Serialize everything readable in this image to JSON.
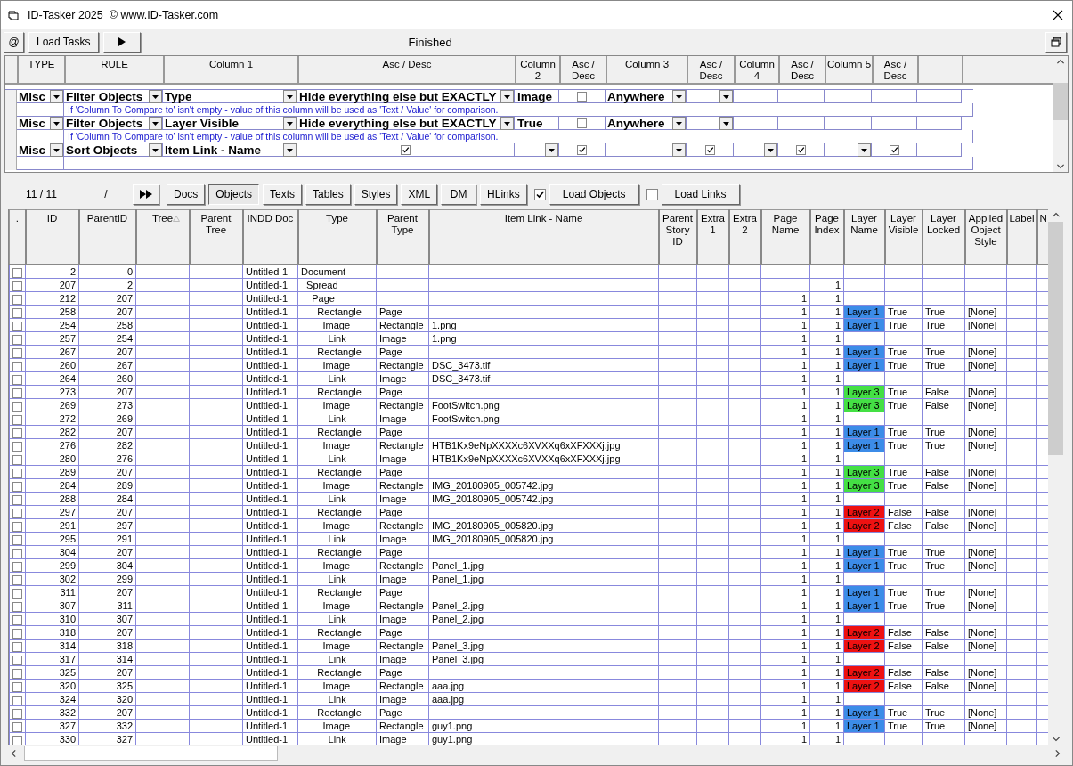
{
  "window": {
    "title": "ID-Tasker 2025  © www.ID-Tasker.com"
  },
  "toolbar": {
    "at_button": "@",
    "load_tasks_button": "Load Tasks",
    "status": "Finished"
  },
  "rules": {
    "columns": [
      "TYPE",
      "RULE",
      "Column 1",
      "Asc / Desc",
      "Column 2",
      "Asc / Desc",
      "Column 3",
      "Asc / Desc",
      "Column 4",
      "Asc / Desc",
      "Column 5",
      "Asc / Desc"
    ],
    "rows": [
      {
        "cells": [
          {
            "kind": "combo",
            "text": "Misc"
          },
          {
            "kind": "combo",
            "text": "Filter Objects"
          },
          {
            "kind": "combo",
            "text": "Type"
          },
          {
            "kind": "combo",
            "text": "Hide everything else but EXACTLY"
          },
          {
            "kind": "text",
            "text": "Image"
          },
          {
            "kind": "check",
            "checked": false
          },
          {
            "kind": "combo",
            "text": "Anywhere"
          },
          {
            "kind": "combo"
          },
          {
            "kind": "empty"
          },
          {
            "kind": "empty"
          },
          {
            "kind": "empty"
          },
          {
            "kind": "empty"
          },
          {
            "kind": "empty"
          }
        ],
        "note": "If 'Column To Compare to' isn't empty - value of this column will be used as 'Text / Value' for comparison."
      },
      {
        "cells": [
          {
            "kind": "combo",
            "text": "Misc"
          },
          {
            "kind": "combo",
            "text": "Filter Objects"
          },
          {
            "kind": "combo",
            "text": "Layer Visible"
          },
          {
            "kind": "combo",
            "text": "Hide everything else but EXACTLY"
          },
          {
            "kind": "text",
            "text": "True"
          },
          {
            "kind": "check",
            "checked": false
          },
          {
            "kind": "combo",
            "text": "Anywhere"
          },
          {
            "kind": "combo"
          },
          {
            "kind": "empty"
          },
          {
            "kind": "empty"
          },
          {
            "kind": "empty"
          },
          {
            "kind": "empty"
          },
          {
            "kind": "empty"
          }
        ],
        "note": "If 'Column To Compare to' isn't empty - value of this column will be used as 'Text / Value' for comparison."
      },
      {
        "cells": [
          {
            "kind": "combo",
            "text": "Misc"
          },
          {
            "kind": "combo",
            "text": "Sort Objects"
          },
          {
            "kind": "combo",
            "text": "Item Link - Name"
          },
          {
            "kind": "check",
            "checked": true
          },
          {
            "kind": "combo"
          },
          {
            "kind": "check",
            "checked": true
          },
          {
            "kind": "combo"
          },
          {
            "kind": "check",
            "checked": true
          },
          {
            "kind": "combo"
          },
          {
            "kind": "check",
            "checked": true
          },
          {
            "kind": "combo"
          },
          {
            "kind": "check",
            "checked": true
          },
          {
            "kind": "empty"
          }
        ]
      }
    ]
  },
  "navigator": {
    "counter": "11 / 11",
    "separator": "/"
  },
  "tabs": [
    {
      "label": "Docs",
      "selected": false
    },
    {
      "label": "Objects",
      "selected": true
    },
    {
      "label": "Texts",
      "selected": false
    },
    {
      "label": "Tables",
      "selected": false
    },
    {
      "label": "Styles",
      "selected": false
    },
    {
      "label": "XML",
      "selected": false
    },
    {
      "label": "DM",
      "selected": false
    },
    {
      "label": "HLinks",
      "selected": false
    }
  ],
  "loaders": [
    {
      "label": "Load Objects",
      "checked": true
    },
    {
      "label": "Load Links",
      "checked": false
    }
  ],
  "table": {
    "checkbox_column_header": ".",
    "columns": [
      "ID",
      "ParentID",
      "Tree",
      "Parent Tree",
      "INDD Doc",
      "Type",
      "Parent Type",
      "Item Link - Name",
      "Parent Story ID",
      "Extra 1",
      "Extra 2",
      "Page Name",
      "Page Index",
      "Layer Name",
      "Layer Visible",
      "Layer Locked",
      "Applied Object Style",
      "Label",
      "N"
    ],
    "rows": [
      {
        "checked": false,
        "cells": [
          "2",
          "0",
          null,
          null,
          "Untitled-1",
          "Document"
        ]
      },
      {
        "checked": false,
        "cells": [
          "207",
          "2",
          null,
          null,
          "Untitled-1",
          "  Spread",
          null,
          null,
          null,
          null,
          null,
          null,
          "1"
        ]
      },
      {
        "checked": false,
        "cells": [
          "212",
          "207",
          null,
          null,
          "Untitled-1",
          "    Page",
          null,
          null,
          null,
          null,
          null,
          "1",
          "1"
        ]
      },
      {
        "checked": false,
        "color": "#3c8ce8",
        "cells": [
          "258",
          "207",
          null,
          null,
          "Untitled-1",
          "      Rectangle",
          "Page",
          null,
          null,
          null,
          null,
          "1",
          "1",
          "Layer 1",
          "True",
          "True",
          "[None]"
        ]
      },
      {
        "checked": false,
        "color": "#3c8ce8",
        "cells": [
          "254",
          "258",
          null,
          null,
          "Untitled-1",
          "        Image",
          "Rectangle",
          "1.png",
          null,
          null,
          null,
          "1",
          "1",
          "Layer 1",
          "True",
          "True",
          "[None]"
        ]
      },
      {
        "checked": false,
        "cells": [
          "257",
          "254",
          null,
          null,
          "Untitled-1",
          "          Link",
          "Image",
          "1.png",
          null,
          null,
          null,
          "1",
          "1"
        ]
      },
      {
        "checked": false,
        "color": "#3c8ce8",
        "cells": [
          "267",
          "207",
          null,
          null,
          "Untitled-1",
          "      Rectangle",
          "Page",
          null,
          null,
          null,
          null,
          "1",
          "1",
          "Layer 1",
          "True",
          "True",
          "[None]"
        ]
      },
      {
        "checked": false,
        "color": "#3c8ce8",
        "cells": [
          "260",
          "267",
          null,
          null,
          "Untitled-1",
          "        Image",
          "Rectangle",
          "DSC_3473.tif",
          null,
          null,
          null,
          "1",
          "1",
          "Layer 1",
          "True",
          "True",
          "[None]"
        ]
      },
      {
        "checked": false,
        "cells": [
          "264",
          "260",
          null,
          null,
          "Untitled-1",
          "          Link",
          "Image",
          "DSC_3473.tif",
          null,
          null,
          null,
          "1",
          "1"
        ]
      },
      {
        "checked": false,
        "color": "#44e044",
        "cells": [
          "273",
          "207",
          null,
          null,
          "Untitled-1",
          "      Rectangle",
          "Page",
          null,
          null,
          null,
          null,
          "1",
          "1",
          "Layer 3",
          "True",
          "False",
          "[None]"
        ]
      },
      {
        "checked": false,
        "color": "#44e044",
        "cells": [
          "269",
          "273",
          null,
          null,
          "Untitled-1",
          "        Image",
          "Rectangle",
          "FootSwitch.png",
          null,
          null,
          null,
          "1",
          "1",
          "Layer 3",
          "True",
          "False",
          "[None]"
        ]
      },
      {
        "checked": false,
        "cells": [
          "272",
          "269",
          null,
          null,
          "Untitled-1",
          "          Link",
          "Image",
          "FootSwitch.png",
          null,
          null,
          null,
          "1",
          "1"
        ]
      },
      {
        "checked": false,
        "color": "#3c8ce8",
        "cells": [
          "282",
          "207",
          null,
          null,
          "Untitled-1",
          "      Rectangle",
          "Page",
          null,
          null,
          null,
          null,
          "1",
          "1",
          "Layer 1",
          "True",
          "True",
          "[None]"
        ]
      },
      {
        "checked": false,
        "color": "#3c8ce8",
        "cells": [
          "276",
          "282",
          null,
          null,
          "Untitled-1",
          "        Image",
          "Rectangle",
          "HTB1Kx9eNpXXXXc6XVXXq6xXFXXXj.jpg",
          null,
          null,
          null,
          "1",
          "1",
          "Layer 1",
          "True",
          "True",
          "[None]"
        ]
      },
      {
        "checked": false,
        "cells": [
          "280",
          "276",
          null,
          null,
          "Untitled-1",
          "          Link",
          "Image",
          "HTB1Kx9eNpXXXXc6XVXXq6xXFXXXj.jpg",
          null,
          null,
          null,
          "1",
          "1"
        ]
      },
      {
        "checked": false,
        "color": "#44e044",
        "cells": [
          "289",
          "207",
          null,
          null,
          "Untitled-1",
          "      Rectangle",
          "Page",
          null,
          null,
          null,
          null,
          "1",
          "1",
          "Layer 3",
          "True",
          "False",
          "[None]"
        ]
      },
      {
        "checked": false,
        "color": "#44e044",
        "cells": [
          "284",
          "289",
          null,
          null,
          "Untitled-1",
          "        Image",
          "Rectangle",
          "IMG_20180905_005742.jpg",
          null,
          null,
          null,
          "1",
          "1",
          "Layer 3",
          "True",
          "False",
          "[None]"
        ]
      },
      {
        "checked": false,
        "cells": [
          "288",
          "284",
          null,
          null,
          "Untitled-1",
          "          Link",
          "Image",
          "IMG_20180905_005742.jpg",
          null,
          null,
          null,
          "1",
          "1"
        ]
      },
      {
        "checked": false,
        "color": "#ee1111",
        "cells": [
          "297",
          "207",
          null,
          null,
          "Untitled-1",
          "      Rectangle",
          "Page",
          null,
          null,
          null,
          null,
          "1",
          "1",
          "Layer 2",
          "False",
          "False",
          "[None]"
        ]
      },
      {
        "checked": false,
        "color": "#ee1111",
        "cells": [
          "291",
          "297",
          null,
          null,
          "Untitled-1",
          "        Image",
          "Rectangle",
          "IMG_20180905_005820.jpg",
          null,
          null,
          null,
          "1",
          "1",
          "Layer 2",
          "False",
          "False",
          "[None]"
        ]
      },
      {
        "checked": false,
        "cells": [
          "295",
          "291",
          null,
          null,
          "Untitled-1",
          "          Link",
          "Image",
          "IMG_20180905_005820.jpg",
          null,
          null,
          null,
          "1",
          "1"
        ]
      },
      {
        "checked": false,
        "color": "#3c8ce8",
        "cells": [
          "304",
          "207",
          null,
          null,
          "Untitled-1",
          "      Rectangle",
          "Page",
          null,
          null,
          null,
          null,
          "1",
          "1",
          "Layer 1",
          "True",
          "True",
          "[None]"
        ]
      },
      {
        "checked": false,
        "color": "#3c8ce8",
        "cells": [
          "299",
          "304",
          null,
          null,
          "Untitled-1",
          "        Image",
          "Rectangle",
          "Panel_1.jpg",
          null,
          null,
          null,
          "1",
          "1",
          "Layer 1",
          "True",
          "True",
          "[None]"
        ]
      },
      {
        "checked": false,
        "cells": [
          "302",
          "299",
          null,
          null,
          "Untitled-1",
          "          Link",
          "Image",
          "Panel_1.jpg",
          null,
          null,
          null,
          "1",
          "1"
        ]
      },
      {
        "checked": false,
        "color": "#3c8ce8",
        "cells": [
          "311",
          "207",
          null,
          null,
          "Untitled-1",
          "      Rectangle",
          "Page",
          null,
          null,
          null,
          null,
          "1",
          "1",
          "Layer 1",
          "True",
          "True",
          "[None]"
        ]
      },
      {
        "checked": false,
        "color": "#3c8ce8",
        "cells": [
          "307",
          "311",
          null,
          null,
          "Untitled-1",
          "        Image",
          "Rectangle",
          "Panel_2.jpg",
          null,
          null,
          null,
          "1",
          "1",
          "Layer 1",
          "True",
          "True",
          "[None]"
        ]
      },
      {
        "checked": false,
        "cells": [
          "310",
          "307",
          null,
          null,
          "Untitled-1",
          "          Link",
          "Image",
          "Panel_2.jpg",
          null,
          null,
          null,
          "1",
          "1"
        ]
      },
      {
        "checked": false,
        "color": "#ee1111",
        "cells": [
          "318",
          "207",
          null,
          null,
          "Untitled-1",
          "      Rectangle",
          "Page",
          null,
          null,
          null,
          null,
          "1",
          "1",
          "Layer 2",
          "False",
          "False",
          "[None]"
        ]
      },
      {
        "checked": false,
        "color": "#ee1111",
        "cells": [
          "314",
          "318",
          null,
          null,
          "Untitled-1",
          "        Image",
          "Rectangle",
          "Panel_3.jpg",
          null,
          null,
          null,
          "1",
          "1",
          "Layer 2",
          "False",
          "False",
          "[None]"
        ]
      },
      {
        "checked": false,
        "cells": [
          "317",
          "314",
          null,
          null,
          "Untitled-1",
          "          Link",
          "Image",
          "Panel_3.jpg",
          null,
          null,
          null,
          "1",
          "1"
        ]
      },
      {
        "checked": false,
        "color": "#ee1111",
        "cells": [
          "325",
          "207",
          null,
          null,
          "Untitled-1",
          "      Rectangle",
          "Page",
          null,
          null,
          null,
          null,
          "1",
          "1",
          "Layer 2",
          "False",
          "False",
          "[None]"
        ]
      },
      {
        "checked": false,
        "color": "#ee1111",
        "cells": [
          "320",
          "325",
          null,
          null,
          "Untitled-1",
          "        Image",
          "Rectangle",
          "aaa.jpg",
          null,
          null,
          null,
          "1",
          "1",
          "Layer 2",
          "False",
          "False",
          "[None]"
        ]
      },
      {
        "checked": false,
        "cells": [
          "324",
          "320",
          null,
          null,
          "Untitled-1",
          "          Link",
          "Image",
          "aaa.jpg",
          null,
          null,
          null,
          "1",
          "1"
        ]
      },
      {
        "checked": false,
        "color": "#3c8ce8",
        "cells": [
          "332",
          "207",
          null,
          null,
          "Untitled-1",
          "      Rectangle",
          "Page",
          null,
          null,
          null,
          null,
          "1",
          "1",
          "Layer 1",
          "True",
          "True",
          "[None]"
        ]
      },
      {
        "checked": false,
        "color": "#3c8ce8",
        "cells": [
          "327",
          "332",
          null,
          null,
          "Untitled-1",
          "        Image",
          "Rectangle",
          "guy1.png",
          null,
          null,
          null,
          "1",
          "1",
          "Layer 1",
          "True",
          "True",
          "[None]"
        ]
      },
      {
        "checked": false,
        "cells": [
          "330",
          "327",
          null,
          null,
          "Untitled-1",
          "          Link",
          "Image",
          "guy1.png",
          null,
          null,
          null,
          "1",
          "1"
        ]
      }
    ]
  }
}
